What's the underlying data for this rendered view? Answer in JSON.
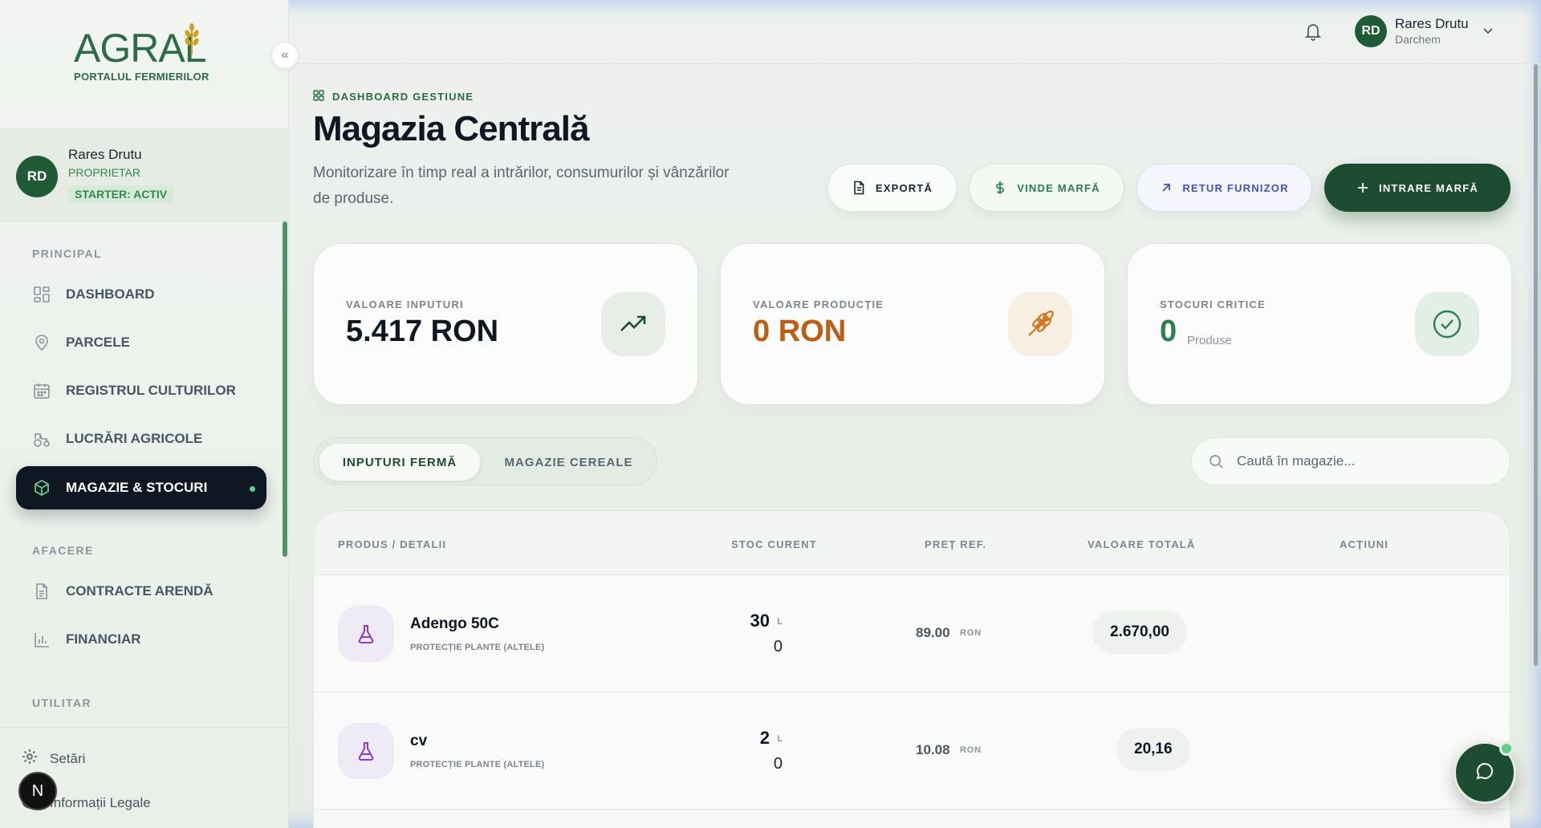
{
  "brand": {
    "name": "AGRAL",
    "tagline": "PORTALUL FERMIERILOR",
    "color": "#2f6b45"
  },
  "sidebar": {
    "user": {
      "initials": "RD",
      "name": "Rares Drutu",
      "role": "PROPRIETAR",
      "plan": "STARTER: ACTIV"
    },
    "sections": {
      "principal": "PRINCIPAL",
      "afacere": "AFACERE",
      "utilitar": "UTILITAR"
    },
    "items": [
      {
        "label": "DASHBOARD",
        "icon": "grid-icon"
      },
      {
        "label": "PARCELE",
        "icon": "map-pin-icon"
      },
      {
        "label": "REGISTRUL CULTURILOR",
        "icon": "calendar-icon"
      },
      {
        "label": "LUCRĂRI AGRICOLE",
        "icon": "tractor-icon"
      },
      {
        "label": "MAGAZIE & STOCURI",
        "icon": "package-icon",
        "active": true
      },
      {
        "label": "CONTRACTE ARENDĂ",
        "icon": "document-icon"
      },
      {
        "label": "FINANCIAR",
        "icon": "bar-chart-icon"
      }
    ],
    "bottom": {
      "settings": "Setări",
      "legal": "Informații Legale"
    },
    "n_badge": "N"
  },
  "topbar": {
    "user_initials": "RD",
    "user_name": "Rares Drutu",
    "user_org": "Darchem"
  },
  "header": {
    "crumb": "DASHBOARD GESTIUNE",
    "title": "Magazia Centrală",
    "description": "Monitorizare în timp real a intrărilor, consumurilor și vânzărilor de produse."
  },
  "actions": {
    "export": "EXPORTĂ",
    "sell": "VINDE MARFĂ",
    "return": "RETUR FURNIZOR",
    "entry": "INTRARE MARFĂ"
  },
  "kpis": [
    {
      "label": "VALOARE INPUTURI",
      "value": "5.417 RON",
      "icon": "trending-up-icon"
    },
    {
      "label": "VALOARE PRODUCȚIE",
      "value": "0 RON",
      "icon": "wheat-icon"
    },
    {
      "label": "STOCURI CRITICE",
      "value": "0",
      "unit": "Produse",
      "icon": "check-circle-icon"
    }
  ],
  "tabs": {
    "tab1": "INPUTURI FERMĂ",
    "tab2": "MAGAZIE CEREALE"
  },
  "search": {
    "placeholder": "Caută în magazie..."
  },
  "table": {
    "headers": [
      "PRODUS / DETALII",
      "STOC CURENT",
      "PREȚ REF.",
      "VALOARE TOTALĂ",
      "ACȚIUNI"
    ],
    "rows": [
      {
        "name": "Adengo 50C",
        "category": "PROTECȚIE PLANTE (ALTELE)",
        "stock": "30",
        "unit": "L",
        "stock_sub": "0",
        "price": "89.00",
        "currency": "RON",
        "total": "2.670,00"
      },
      {
        "name": "cv",
        "category": "PROTECȚIE PLANTE (ALTELE)",
        "stock": "2",
        "unit": "L",
        "stock_sub": "0",
        "price": "10.08",
        "currency": "RON",
        "total": "20,16"
      }
    ]
  },
  "colors": {
    "primary": "#1c4d30",
    "accent_green": "#2a8050",
    "orange": "#c05b12",
    "blue": "#3d55c7",
    "purple": "#8a3dd6"
  }
}
